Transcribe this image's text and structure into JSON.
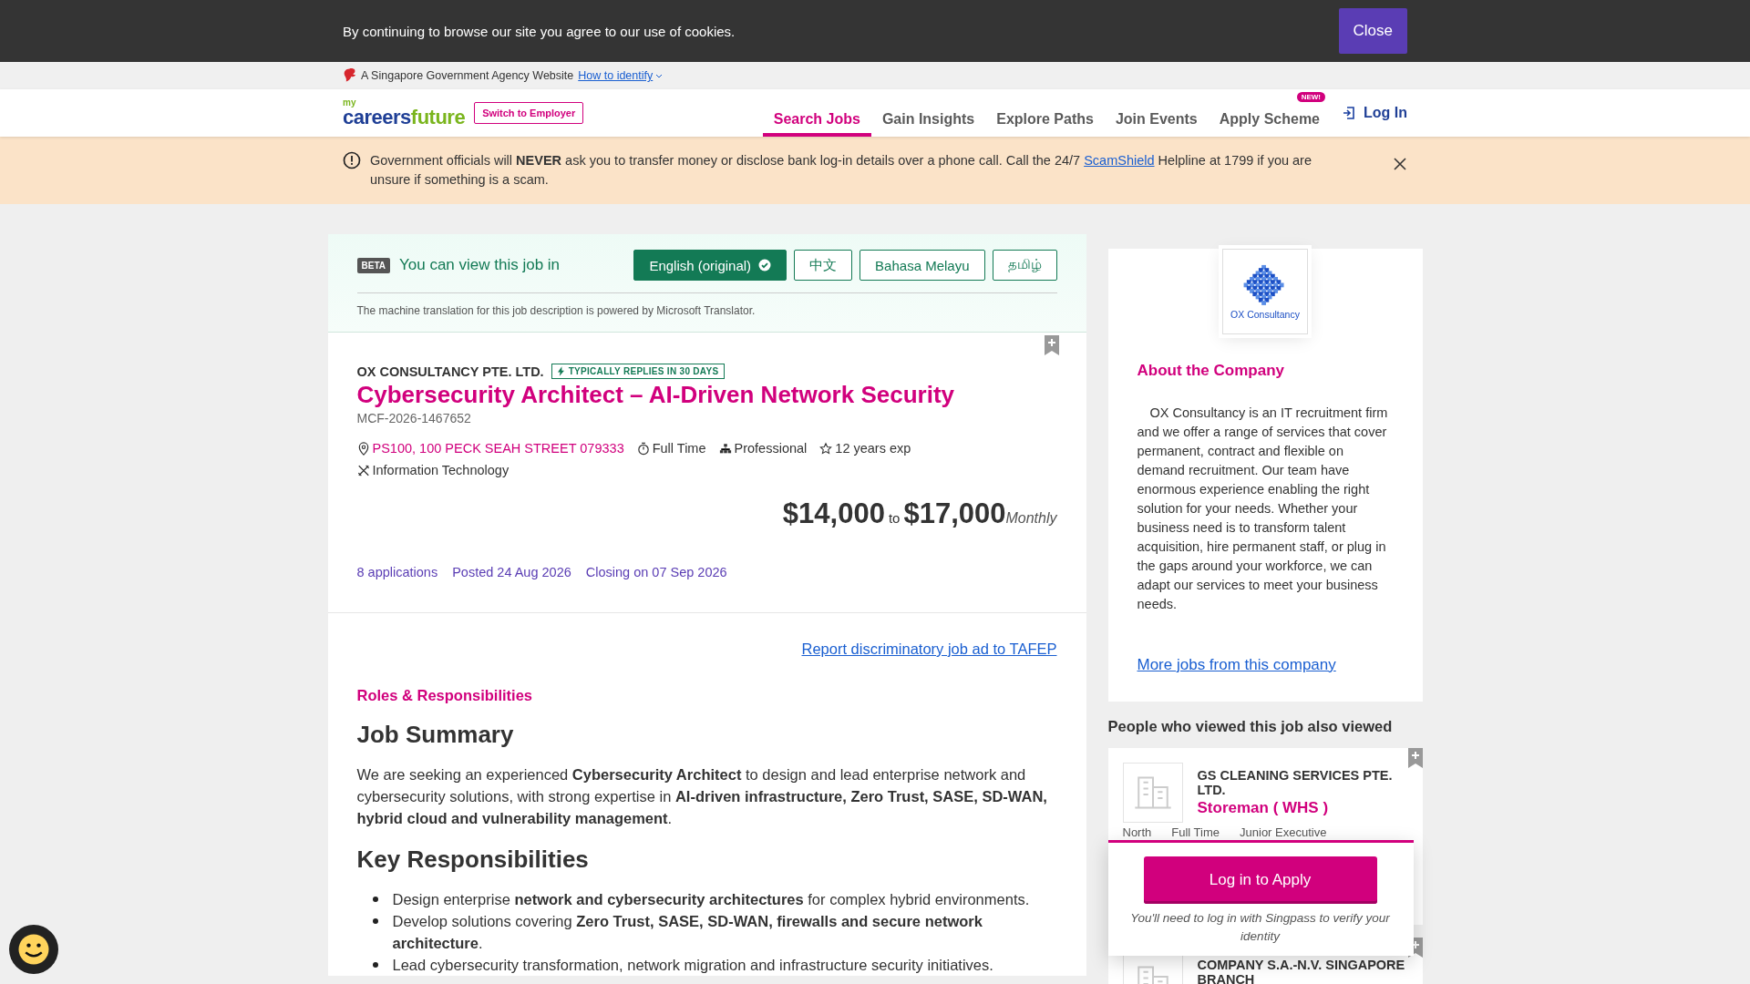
{
  "cookie_bar": {
    "message": "By continuing to browse our site you agree to our use of cookies.",
    "close_button": "Close"
  },
  "gov_banner": {
    "text": "A Singapore Government Agency Website",
    "link": "How to identify"
  },
  "header": {
    "logo": {
      "prefix": "my",
      "first": "careers",
      "second": "future"
    },
    "switch_button": "Switch to Employer",
    "nav": [
      {
        "label": "Search Jobs",
        "selected": true
      },
      {
        "label": "Gain Insights",
        "selected": false
      },
      {
        "label": "Explore Paths",
        "selected": false
      },
      {
        "label": "Join Events",
        "selected": false
      },
      {
        "label": "Apply Scheme",
        "selected": false,
        "badge": "NEW!"
      }
    ],
    "login": "Log In"
  },
  "alert": {
    "before": "Government officials will **NEVER** ask you to transfer money or disclose bank log-in details over a phone call. Call the 24/7 ",
    "link": "ScamShield",
    "after": " Helpline at 1799 if you are unsure if something is a scam."
  },
  "translation": {
    "badge": "BETA",
    "prompt": "You can view this job in",
    "languages": [
      {
        "label": "English (original)",
        "selected": true
      },
      {
        "label": "中文",
        "selected": false
      },
      {
        "label": "Bahasa Melayu",
        "selected": false
      },
      {
        "label": "தமிழ்",
        "selected": false
      }
    ],
    "note": "The machine translation for this job description is powered by Microsoft Translator."
  },
  "job": {
    "company": "OX CONSULTANCY PTE. LTD.",
    "reply_badge": "TYPICALLY REPLIES IN 30 DAYS",
    "title": "Cybersecurity Architect – AI-Driven Network Security",
    "id": "MCF-2026-1467652",
    "meta": [
      {
        "kind": "location",
        "text": "PS100, 100 PECK SEAH STREET 079333"
      },
      {
        "kind": "employment",
        "text": "Full Time"
      },
      {
        "kind": "seniority",
        "text": "Professional"
      },
      {
        "kind": "experience",
        "text": "12 years exp"
      },
      {
        "kind": "category",
        "text": "Information Technology"
      }
    ],
    "salary": {
      "min": "$14,000",
      "to": "to",
      "max": "$17,000",
      "period": "Monthly"
    },
    "stats": [
      "8 applications",
      "Posted 24 Aug 2026",
      "Closing on 07 Sep 2026"
    ]
  },
  "description": {
    "report_link": "Report discriminatory job ad to TAFEP",
    "section_label": "Roles & Responsibilities",
    "blocks": [
      {
        "kind": "heading",
        "text": "Job Summary"
      },
      {
        "kind": "paragraph",
        "text": "We are seeking an experienced **Cybersecurity Architect** to design and lead enterprise network and cybersecurity solutions, with strong expertise in **AI-driven infrastructure, Zero Trust, SASE, SD-WAN, hybrid cloud and vulnerability management**."
      },
      {
        "kind": "heading",
        "text": "Key Responsibilities"
      },
      {
        "kind": "list",
        "items": [
          "Design enterprise  **network and cybersecurity architectures** for complex hybrid environments.",
          "Develop solutions covering  **Zero Trust, SASE, SD-WAN, firewalls and secure network architecture**.",
          "Lead cybersecurity transformation, network migration and infrastructure security initiatives."
        ]
      }
    ]
  },
  "company": {
    "logo_text": "OX Consultancy",
    "heading": "About the Company",
    "about": "OX Consultancy is an IT recruitment firm and we offer a range of services that cover permanent, contract and flexible on demand recruitment. Our team have enormous experience enabling the right solution for your needs. Whether your business need is to transform talent acquisition, hire permanent staff, or plug in the gaps around your workforce, we can adapt our services to meet your business needs.",
    "more_link": "More jobs from this company"
  },
  "similar": {
    "heading": "People who viewed this job also viewed",
    "jobs": [
      {
        "company": "GS CLEANING SERVICES PTE. LTD.",
        "title": "Storeman ( WHS )",
        "meta": [
          "North",
          "Full Time",
          "Junior Executive"
        ]
      },
      {
        "company": "COMPANY S.A.-N.V. SINGAPORE BRANCH"
      }
    ]
  },
  "apply": {
    "button": "Log in to Apply",
    "note": "You'll need to log in with Singpass to verify your identity"
  }
}
